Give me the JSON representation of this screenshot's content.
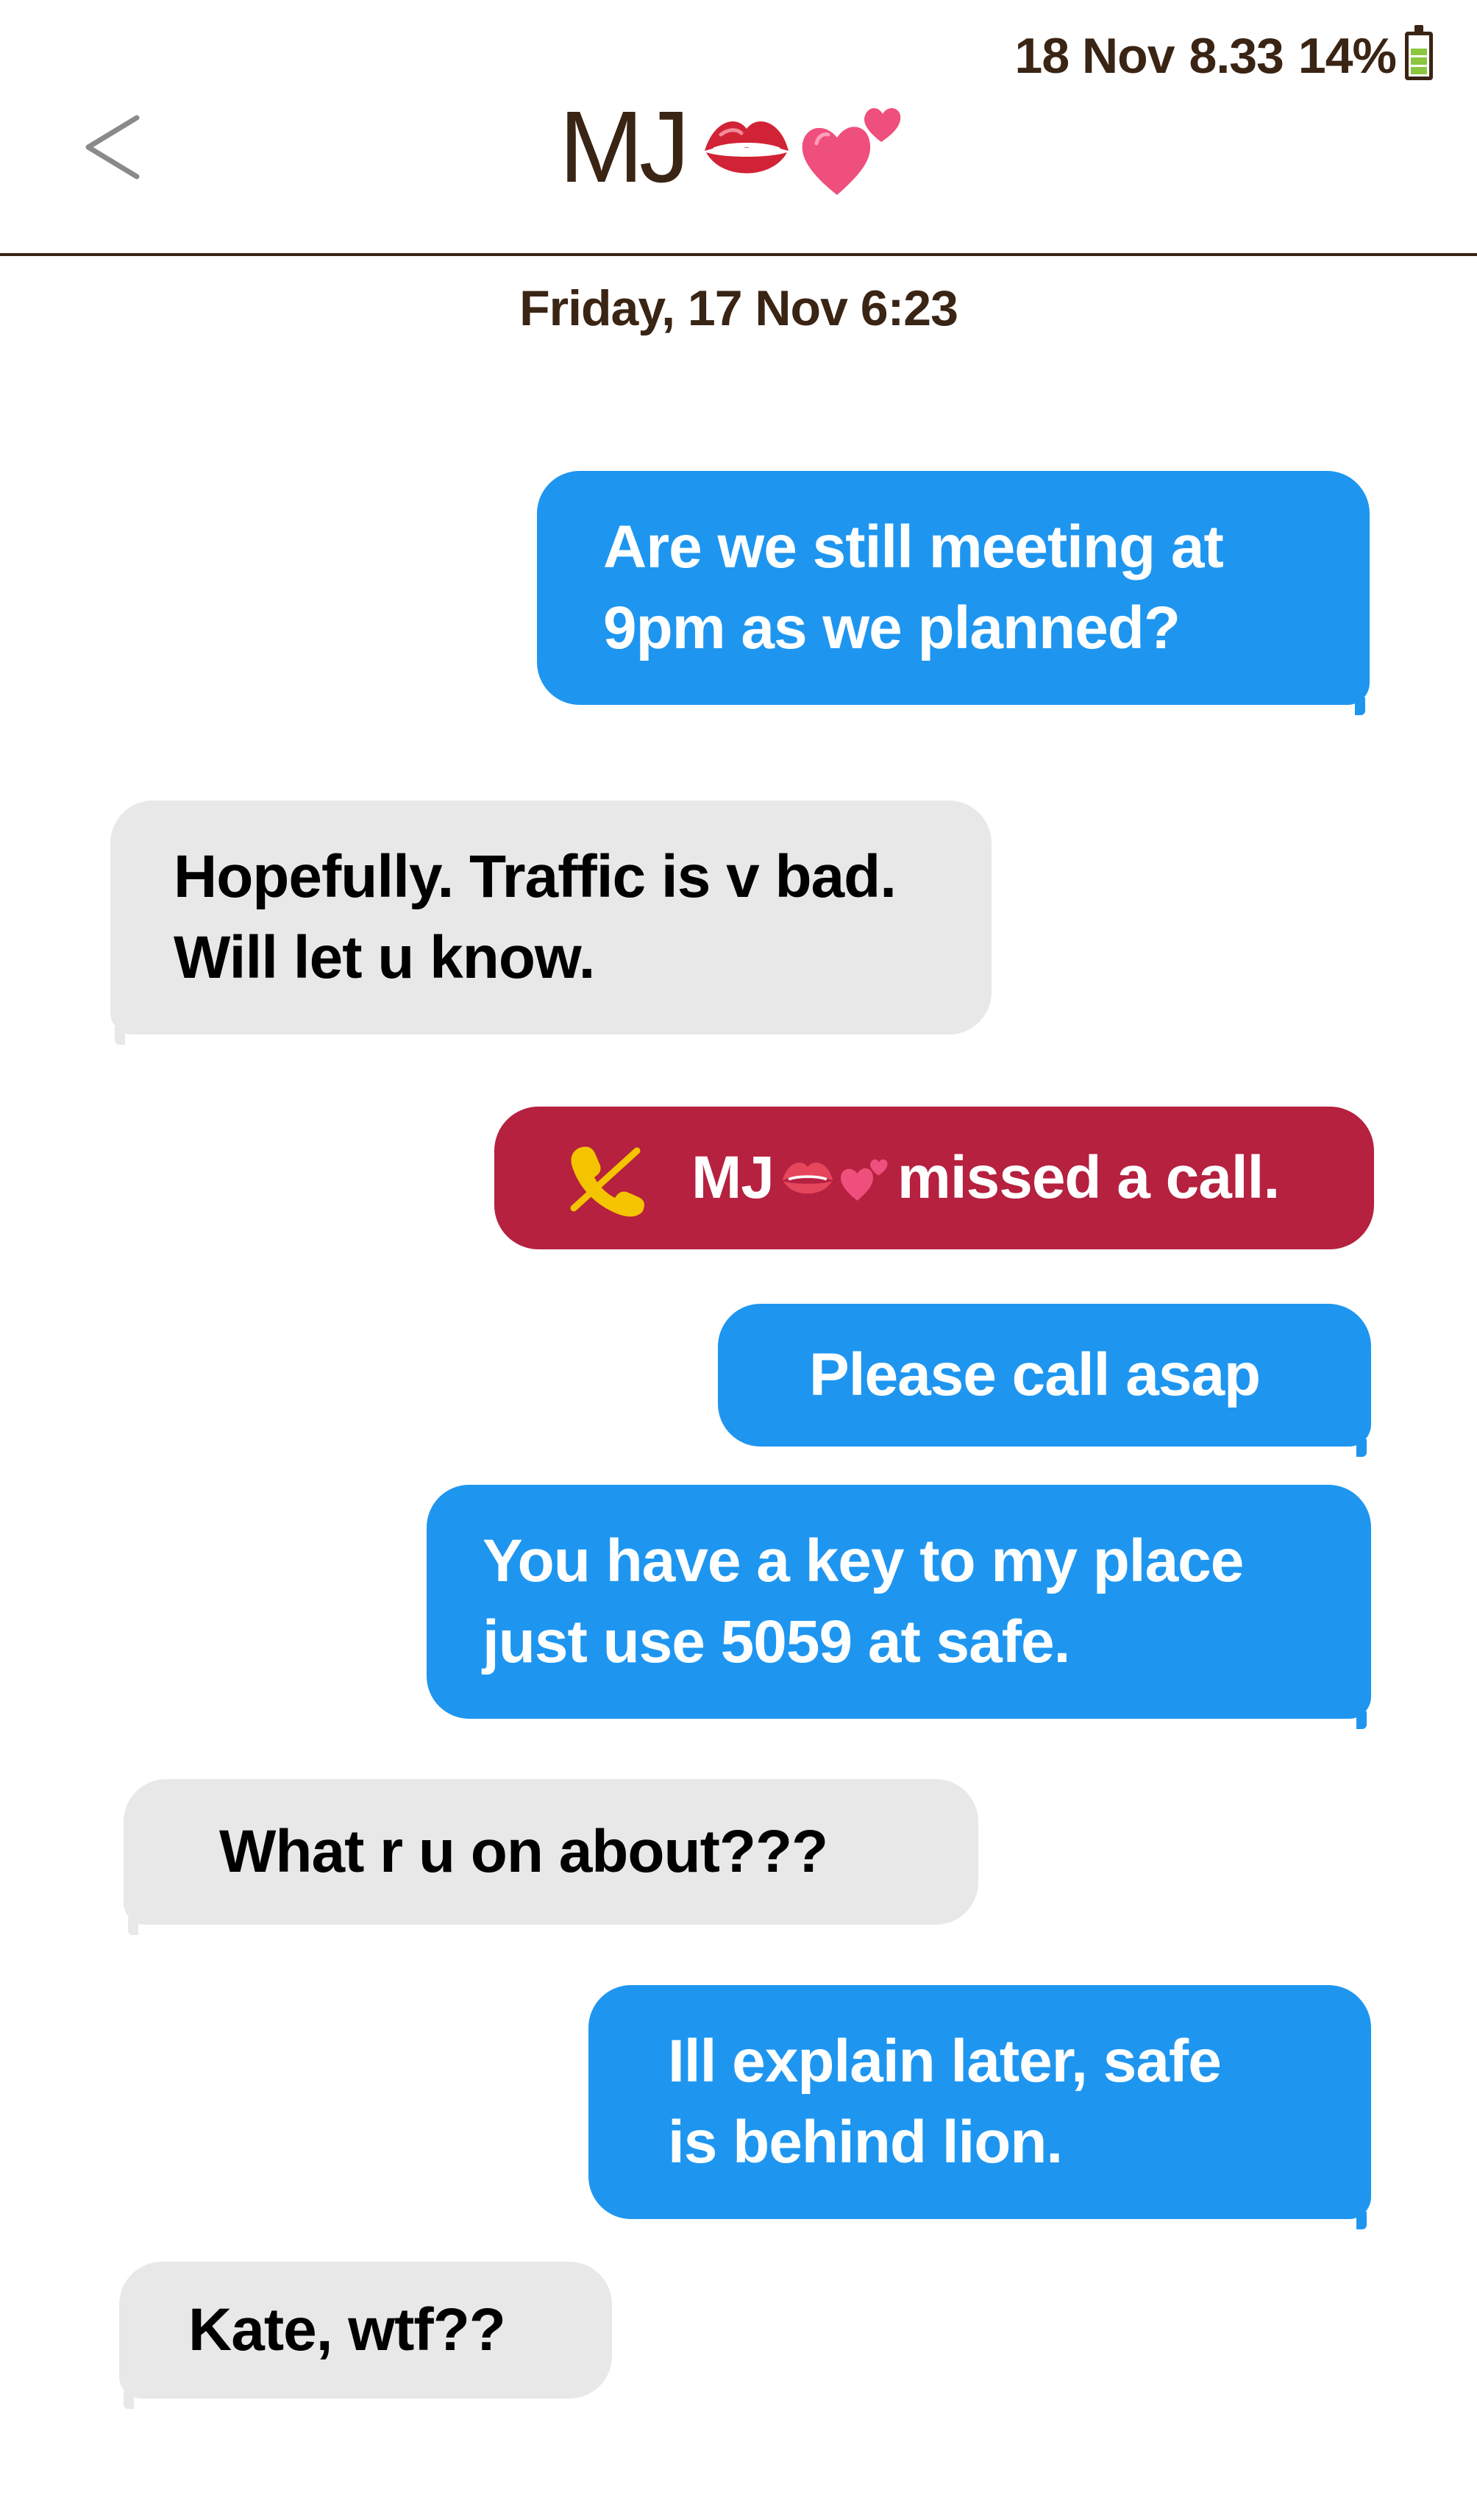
{
  "status_bar": {
    "date": "18 Nov",
    "time": "8.33",
    "battery_percent": "14%",
    "battery_level": 0.14
  },
  "header": {
    "contact_name": "MJ",
    "contact_emojis": [
      "kiss-mark-icon",
      "two-hearts-icon"
    ],
    "back_label": "<"
  },
  "conversation": {
    "date_stamp": "Friday, 17 Nov 6:23",
    "messages": [
      {
        "direction": "outgoing",
        "text": "Are we still meeting at\n9pm as we planned?"
      },
      {
        "direction": "incoming",
        "text": "Hopefully. Traffic is v bad.\nWill let u know."
      },
      {
        "direction": "system",
        "type": "missed-call",
        "name": "MJ",
        "text": "missed a call."
      },
      {
        "direction": "outgoing",
        "text": "Please call asap"
      },
      {
        "direction": "outgoing",
        "text": "You have a key to my place\njust use 5059 at safe."
      },
      {
        "direction": "incoming",
        "text": "What r u on about???"
      },
      {
        "direction": "outgoing",
        "text": "Ill explain later,  safe\nis behind lion."
      },
      {
        "direction": "incoming",
        "text": "Kate, wtf??"
      }
    ]
  },
  "colors": {
    "outgoing_bubble": "#1e96f0",
    "incoming_bubble": "#e8e8e8",
    "missed_call_bubble": "#b5213f",
    "header_text": "#3a2414",
    "battery_fill": "#8cc63f",
    "phone_icon": "#f5c400"
  }
}
